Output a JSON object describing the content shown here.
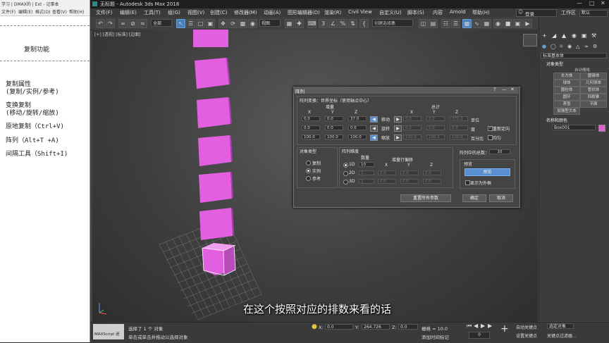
{
  "notes": {
    "top_labels": [
      "学习 | DMAX的 | Ext - 记事本",
      "文件(F)",
      "编辑(E)",
      "格式(O)",
      "查看(V)",
      "帮助(H)"
    ],
    "heading": "复制功能",
    "lines": [
      "复制属性",
      "(复制/实例/参考)",
      "变换复制",
      "(移动/旋转/缩放)",
      "原地复制（Ctrl+V)",
      "阵列（Alt+T +A)",
      "间隔工具（Shift+I)"
    ]
  },
  "app": {
    "title": "无标题 - Autodesk 3ds Max 2018",
    "menus": [
      "文件(F)",
      "编辑(E)",
      "工具(T)",
      "组(G)",
      "视图(V)",
      "创建(C)",
      "修改器(M)",
      "动画(A)",
      "图形编辑器(D)",
      "渲染(R)",
      "Civil View",
      "自定义(U)",
      "脚本(S)",
      "内容",
      "Arnold",
      "帮助(H)"
    ],
    "login": "登录",
    "workspace_label": "工作区",
    "workspace_value": "默认",
    "selection_filter": "全部",
    "view_dropdown": "视图",
    "selection_set": "创建选择集",
    "viewport_label": "[+] [透视] [标准] [边面]"
  },
  "command_panel": {
    "object_name_dropdown": "标准基本体",
    "section_object_type": "对象类型",
    "autogrid": "自动栅格",
    "buttons": [
      "长方体",
      "圆锥体",
      "球体",
      "几何球体",
      "圆柱体",
      "管状体",
      "圆环",
      "四棱锥",
      "茶壶",
      "平面",
      "加强型文本"
    ],
    "section_name_color": "名称和颜色",
    "object_name": "Box001",
    "object_color": "#e060d0"
  },
  "dialog": {
    "title": "阵列",
    "transform_header": "阵列变换：世界坐标（使用轴点中心）",
    "increment_label": "增量",
    "total_label": "总计",
    "axes": [
      "X",
      "Y",
      "Z"
    ],
    "rows": [
      {
        "label": "移动",
        "inc": [
          "0.0",
          "0.0",
          "37.0"
        ],
        "total": [
          "0.0",
          "0.0",
          "370.0"
        ],
        "unit": "单位"
      },
      {
        "label": "旋转",
        "inc": [
          "0.0",
          "0.0",
          "0.0"
        ],
        "total": [
          "0.0",
          "0.0",
          "0.0"
        ],
        "unit": "度"
      },
      {
        "label": "缩放",
        "inc": [
          "100.0",
          "100.0",
          "100.0"
        ],
        "total": [
          "100.0",
          "100.0",
          "100.0"
        ],
        "unit": "百分比"
      }
    ],
    "reorient_label": "重新定向",
    "uniform_label": "均匀",
    "object_type_header": "对象类型",
    "object_types": [
      "复制",
      "实例",
      "参考"
    ],
    "object_type_selected": 1,
    "dimensions_header": "阵列维度",
    "count_label": "数量",
    "incremental_offset_label": "增量行偏移",
    "dims": [
      {
        "label": "1D",
        "count": "10"
      },
      {
        "label": "2D",
        "count": "1",
        "offset": [
          "0.0",
          "0.0",
          "0.0"
        ]
      },
      {
        "label": "3D",
        "count": "1",
        "offset": [
          "0.0",
          "0.0",
          "0.0"
        ]
      }
    ],
    "total_in_array_label": "阵列中的总数：",
    "total_in_array": "10",
    "preview_header": "预览",
    "preview_button": "预览",
    "display_as_box": "显示为外框",
    "reset_button": "重置所有参数",
    "ok_button": "确定",
    "cancel_button": "取消"
  },
  "status": {
    "maxscript": "MAXScript 迷",
    "selected": "选择了 1 个 对象",
    "hint": "单击或单击并拖动以选择对象",
    "x_label": "X:",
    "x_value": "0.0",
    "y_label": "Y:",
    "y_value": "264.726",
    "z_label": "Z:",
    "z_value": "0.0",
    "grid": "栅格 = 10.0",
    "add_time_tag": "添加时间标记",
    "auto_key": "自动关键点",
    "selected_obj": "选定对象",
    "set_key": "设置关键点",
    "key_filter": "关键点过滤器...",
    "frame": "0"
  },
  "subtitle": "在这个按照对应的排数来看的话",
  "colors": {
    "cube": "#e25fe0",
    "cube_shadow": "#a63ea8",
    "accent_blue": "#4a7fb8"
  }
}
